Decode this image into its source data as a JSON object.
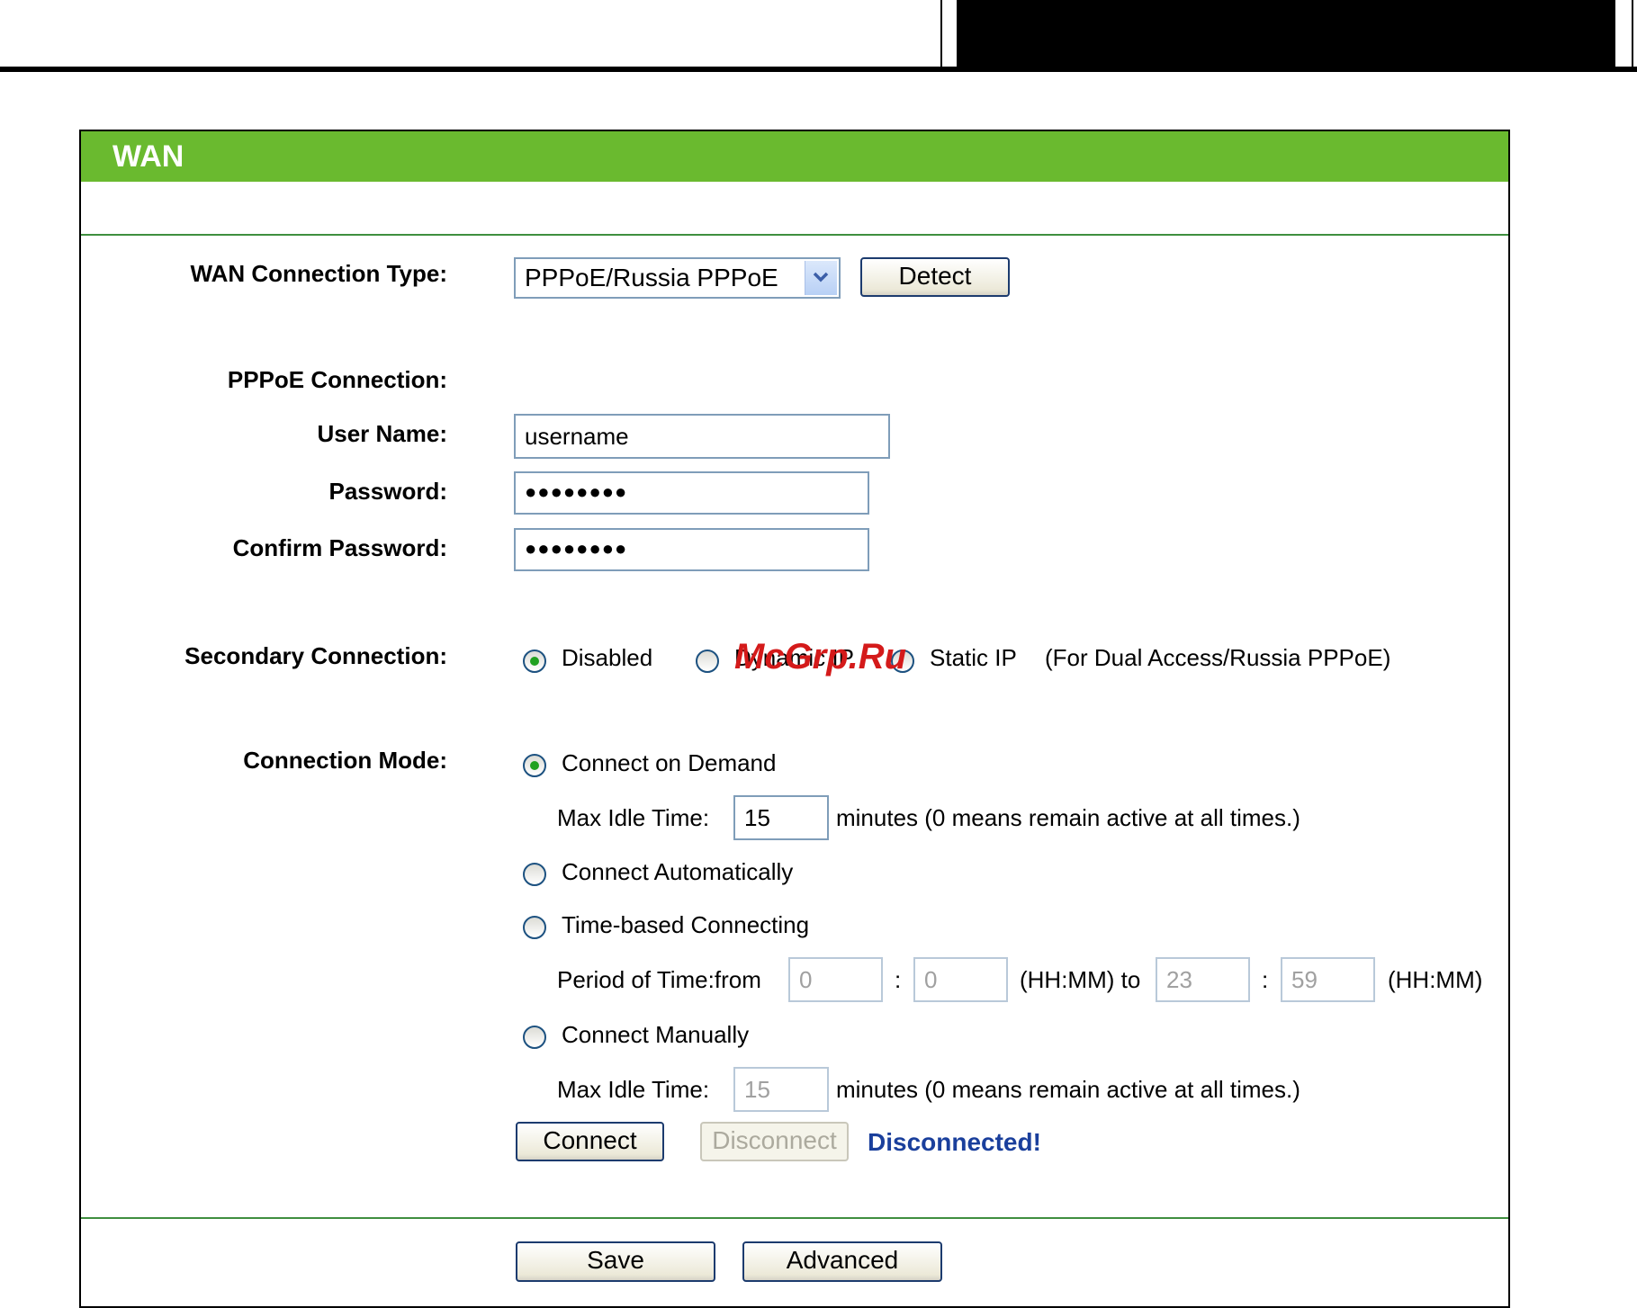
{
  "header": {
    "title": "WAN"
  },
  "connection_type": {
    "label": "WAN Connection Type:",
    "selected": "PPPoE/Russia PPPoE",
    "detect_label": "Detect"
  },
  "pppoe": {
    "section_label": "PPPoE Connection:",
    "username_label": "User Name:",
    "username_value": "username",
    "password_label": "Password:",
    "password_value": "●●●●●●●●",
    "confirm_label": "Confirm Password:",
    "confirm_value": "●●●●●●●●"
  },
  "secondary": {
    "label": "Secondary Connection:",
    "options": [
      {
        "label": "Disabled",
        "selected": true
      },
      {
        "label": "Dynamic IP",
        "selected": false
      },
      {
        "label": "Static IP",
        "selected": false
      }
    ],
    "note": "(For Dual Access/Russia PPPoE)"
  },
  "watermark": "McGrp.Ru",
  "mode": {
    "label": "Connection Mode:",
    "on_demand": "Connect on Demand",
    "max_idle_label": "Max Idle Time:",
    "max_idle_value": "15",
    "max_idle_note": "minutes (0 means remain active at all times.)",
    "automatic": "Connect Automatically",
    "time_based": "Time-based Connecting",
    "period_label": "Period of Time:from",
    "from_hh": "0",
    "from_mm": "0",
    "colon": ":",
    "hhmm_to": "(HH:MM) to",
    "to_hh": "23",
    "to_mm": "59",
    "hhmm": "(HH:MM)",
    "manual": "Connect Manually",
    "manual_idle_label": "Max Idle Time:",
    "manual_idle_value": "15",
    "manual_idle_note": "minutes (0 means remain active at all times.)",
    "selected": "on_demand"
  },
  "actions": {
    "connect": "Connect",
    "disconnect": "Disconnect",
    "status": "Disconnected!",
    "save": "Save",
    "advanced": "Advanced"
  },
  "colors": {
    "header_green": "#6aba2f",
    "status_blue": "#1a3f9c",
    "radio_green": "#21a121"
  }
}
